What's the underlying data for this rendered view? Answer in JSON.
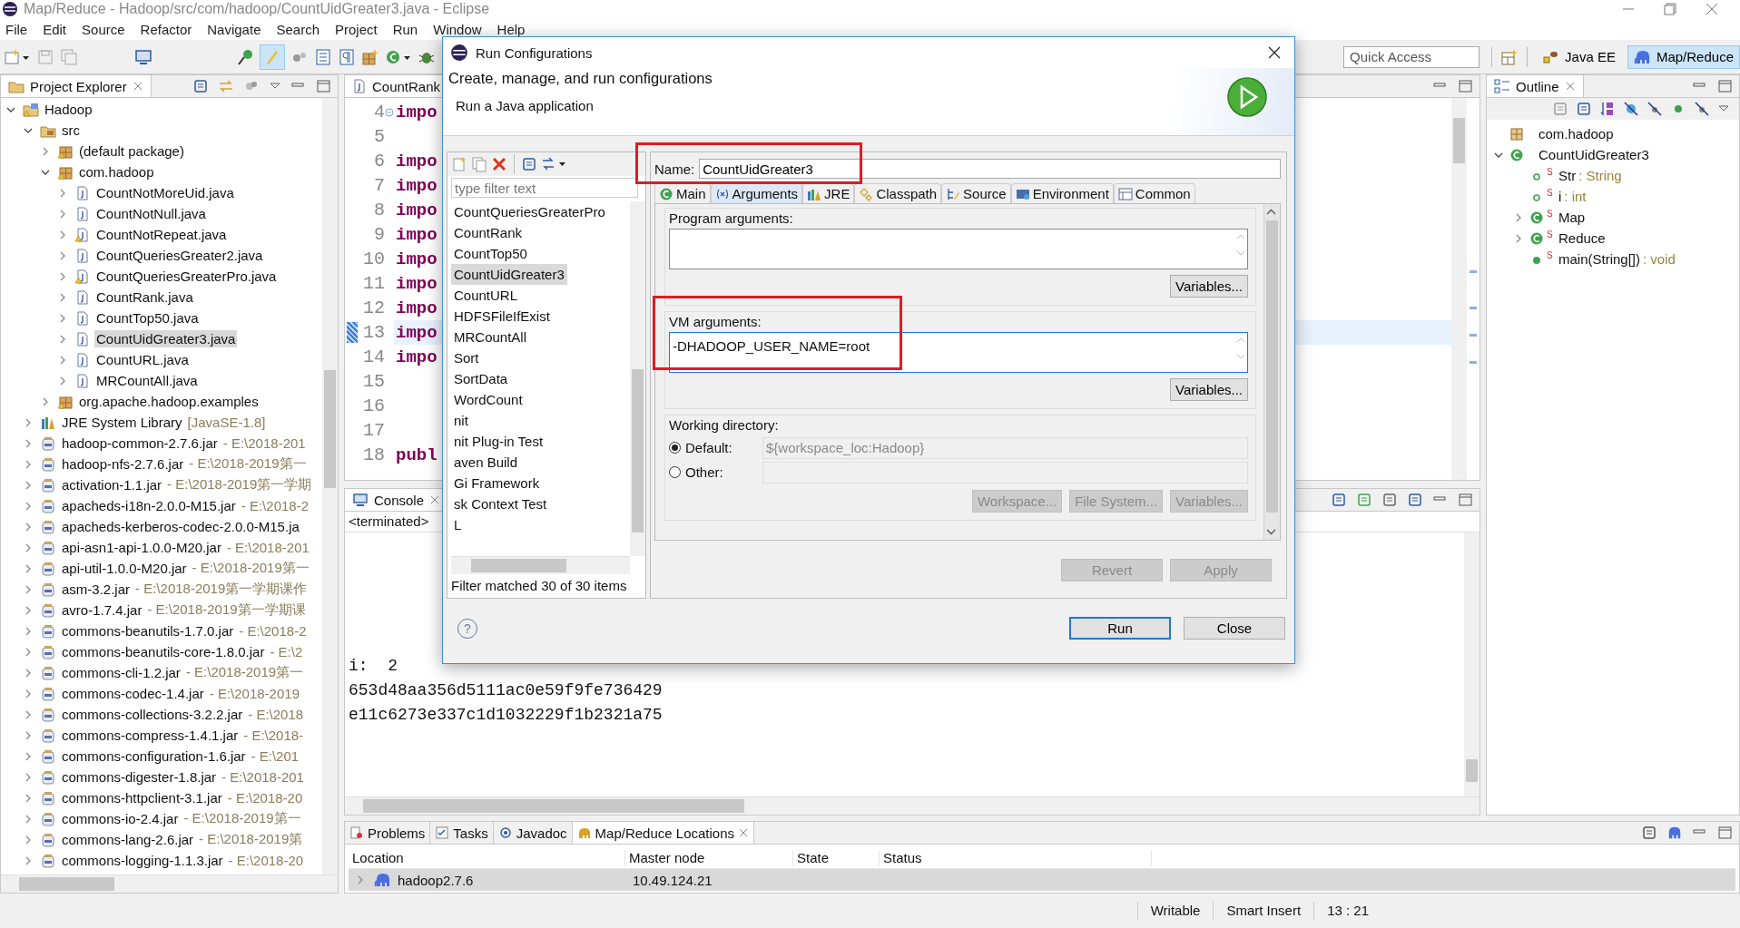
{
  "window": {
    "title": "Map/Reduce - Hadoop/src/com/hadoop/CountUidGreater3.java - Eclipse"
  },
  "menu": [
    "File",
    "Edit",
    "Source",
    "Refactor",
    "Navigate",
    "Search",
    "Project",
    "Run",
    "Window",
    "Help"
  ],
  "toolbar": {
    "quick_access": {
      "placeholder": "Quick Access"
    },
    "perspectives": [
      {
        "label": "Java EE",
        "kind": "javaee",
        "selected": false
      },
      {
        "label": "Map/Reduce",
        "kind": "mapreduce",
        "selected": true
      }
    ]
  },
  "project_explorer": {
    "title": "Project Explorer",
    "tree": [
      {
        "label": "Hadoop",
        "kind": "project",
        "warning": true,
        "expanded": true,
        "selected": false,
        "children": [
          {
            "label": "src",
            "kind": "folder",
            "warning": false,
            "expanded": true,
            "selected": false,
            "children": [
              {
                "label": "(default package)",
                "kind": "package",
                "warning": true,
                "expanded": false,
                "selected": false
              },
              {
                "label": "com.hadoop",
                "kind": "package",
                "warning": true,
                "expanded": true,
                "selected": false,
                "children": [
                  {
                    "label": "CountNotMoreUid.java",
                    "kind": "java",
                    "warning": false,
                    "expanded": false,
                    "selected": false
                  },
                  {
                    "label": "CountNotNull.java",
                    "kind": "java",
                    "warning": false,
                    "expanded": false,
                    "selected": false
                  },
                  {
                    "label": "CountNotRepeat.java",
                    "kind": "java",
                    "warning": true,
                    "expanded": false,
                    "selected": false
                  },
                  {
                    "label": "CountQueriesGreater2.java",
                    "kind": "java",
                    "warning": false,
                    "expanded": false,
                    "selected": false
                  },
                  {
                    "label": "CountQueriesGreaterPro.java",
                    "kind": "java",
                    "warning": true,
                    "expanded": false,
                    "selected": false
                  },
                  {
                    "label": "CountRank.java",
                    "kind": "java",
                    "warning": false,
                    "expanded": false,
                    "selected": false
                  },
                  {
                    "label": "CountTop50.java",
                    "kind": "java",
                    "warning": false,
                    "expanded": false,
                    "selected": false
                  },
                  {
                    "label": "CountUidGreater3.java",
                    "kind": "java",
                    "warning": false,
                    "expanded": false,
                    "selected": true
                  },
                  {
                    "label": "CountURL.java",
                    "kind": "java",
                    "warning": false,
                    "expanded": false,
                    "selected": false
                  },
                  {
                    "label": "MRCountAll.java",
                    "kind": "java",
                    "warning": false,
                    "expanded": false,
                    "selected": false
                  }
                ]
              },
              {
                "label": "org.apache.hadoop.examples",
                "kind": "package",
                "warning": true,
                "expanded": false,
                "selected": false
              }
            ]
          },
          {
            "label": "JRE System Library",
            "detail": "[JavaSE-1.8]",
            "kind": "library",
            "warning": false,
            "expanded": false,
            "selected": false
          },
          {
            "label": "hadoop-common-2.7.6.jar",
            "detail": "- E:\\2018-201",
            "kind": "jar",
            "warning": false,
            "expanded": false,
            "selected": false
          },
          {
            "label": "hadoop-nfs-2.7.6.jar",
            "detail": "- E:\\2018-2019第一",
            "kind": "jar",
            "warning": false,
            "expanded": false,
            "selected": false
          },
          {
            "label": "activation-1.1.jar",
            "detail": "- E:\\2018-2019第一学期",
            "kind": "jar",
            "warning": false,
            "expanded": false,
            "selected": false
          },
          {
            "label": "apacheds-i18n-2.0.0-M15.jar",
            "detail": "- E:\\2018-2",
            "kind": "jar",
            "warning": false,
            "expanded": false,
            "selected": false
          },
          {
            "label": "apacheds-kerberos-codec-2.0.0-M15.ja",
            "kind": "jar",
            "warning": false,
            "expanded": false,
            "selected": false
          },
          {
            "label": "api-asn1-api-1.0.0-M20.jar",
            "detail": "- E:\\2018-201",
            "kind": "jar",
            "warning": false,
            "expanded": false,
            "selected": false
          },
          {
            "label": "api-util-1.0.0-M20.jar",
            "detail": "- E:\\2018-2019第一",
            "kind": "jar",
            "warning": false,
            "expanded": false,
            "selected": false
          },
          {
            "label": "asm-3.2.jar",
            "detail": "- E:\\2018-2019第一学期课作",
            "kind": "jar",
            "warning": false,
            "expanded": false,
            "selected": false
          },
          {
            "label": "avro-1.7.4.jar",
            "detail": "- E:\\2018-2019第一学期课",
            "kind": "jar",
            "warning": false,
            "expanded": false,
            "selected": false
          },
          {
            "label": "commons-beanutils-1.7.0.jar",
            "detail": "- E:\\2018-2",
            "kind": "jar",
            "warning": false,
            "expanded": false,
            "selected": false
          },
          {
            "label": "commons-beanutils-core-1.8.0.jar",
            "detail": "- E:\\2",
            "kind": "jar",
            "warning": false,
            "expanded": false,
            "selected": false
          },
          {
            "label": "commons-cli-1.2.jar",
            "detail": "- E:\\2018-2019第一",
            "kind": "jar",
            "warning": false,
            "expanded": false,
            "selected": false
          },
          {
            "label": "commons-codec-1.4.jar",
            "detail": "- E:\\2018-2019",
            "kind": "jar",
            "warning": false,
            "expanded": false,
            "selected": false
          },
          {
            "label": "commons-collections-3.2.2.jar",
            "detail": "- E:\\2018",
            "kind": "jar",
            "warning": false,
            "expanded": false,
            "selected": false
          },
          {
            "label": "commons-compress-1.4.1.jar",
            "detail": "- E:\\2018-",
            "kind": "jar",
            "warning": false,
            "expanded": false,
            "selected": false
          },
          {
            "label": "commons-configuration-1.6.jar",
            "detail": "- E:\\201",
            "kind": "jar",
            "warning": false,
            "expanded": false,
            "selected": false
          },
          {
            "label": "commons-digester-1.8.jar",
            "detail": "- E:\\2018-201",
            "kind": "jar",
            "warning": false,
            "expanded": false,
            "selected": false
          },
          {
            "label": "commons-httpclient-3.1.jar",
            "detail": "- E:\\2018-20",
            "kind": "jar",
            "warning": false,
            "expanded": false,
            "selected": false
          },
          {
            "label": "commons-io-2.4.jar",
            "detail": "- E:\\2018-2019第一",
            "kind": "jar",
            "warning": false,
            "expanded": false,
            "selected": false
          },
          {
            "label": "commons-lang-2.6.jar",
            "detail": "- E:\\2018-2019第",
            "kind": "jar",
            "warning": false,
            "expanded": false,
            "selected": false
          },
          {
            "label": "commons-logging-1.1.3.jar",
            "detail": "- E:\\2018-20",
            "kind": "jar",
            "warning": false,
            "expanded": false,
            "selected": false
          }
        ]
      }
    ]
  },
  "editor": {
    "tab": "CountRank",
    "lines": [
      {
        "number": "4",
        "code": "impo",
        "fold": true,
        "current": false
      },
      {
        "number": "5",
        "fold": false,
        "current": false
      },
      {
        "number": "6",
        "code": "impo",
        "fold": false,
        "current": false
      },
      {
        "number": "7",
        "code": "impo",
        "fold": false,
        "current": false
      },
      {
        "number": "8",
        "code": "impo",
        "fold": false,
        "current": false
      },
      {
        "number": "9",
        "code": "impo",
        "fold": false,
        "current": false
      },
      {
        "number": "10",
        "code": "impo",
        "fold": false,
        "current": false
      },
      {
        "number": "11",
        "code": "impo",
        "fold": false,
        "current": false
      },
      {
        "number": "12",
        "code": "impo",
        "fold": false,
        "current": false
      },
      {
        "number": "13",
        "code": "impo",
        "fold": false,
        "current": true
      },
      {
        "number": "14",
        "code": "impo",
        "fold": false,
        "current": false
      },
      {
        "number": "15",
        "fold": false,
        "current": false
      },
      {
        "number": "16",
        "fold": false,
        "current": false
      },
      {
        "number": "17",
        "fold": false,
        "current": false
      },
      {
        "number": "18",
        "code": "publ",
        "fold": false,
        "current": false
      }
    ]
  },
  "console": {
    "title": "Console",
    "status": "<terminated>",
    "output": [
      "i:  2",
      "653d48aa356d5111ac0e59f9fe736429",
      "e11c6273e337c1d1032229f1b2321a75"
    ]
  },
  "outline": {
    "title": "Outline",
    "tree": [
      {
        "label": "com.hadoop",
        "kind": "package"
      },
      {
        "label": "CountUidGreater3",
        "kind": "class",
        "expanded": true,
        "children": [
          {
            "label": "Str",
            "type": ": String",
            "kind": "field",
            "modifier": "S"
          },
          {
            "label": "i",
            "type": ": int",
            "kind": "field",
            "modifier": "S"
          },
          {
            "label": "Map",
            "kind": "class",
            "modifier": "S",
            "expanded": false
          },
          {
            "label": "Reduce",
            "kind": "class",
            "modifier": "S",
            "expanded": false
          },
          {
            "label": "main(String[])",
            "type": ": void",
            "kind": "method",
            "modifier": "S"
          }
        ]
      }
    ]
  },
  "bottom_panel": {
    "tabs": [
      {
        "label": "Problems",
        "kind": "problems",
        "selected": false
      },
      {
        "label": "Tasks",
        "kind": "tasks",
        "selected": false
      },
      {
        "label": "Javadoc",
        "kind": "javadoc",
        "selected": false
      },
      {
        "label": "Map/Reduce Locations",
        "kind": "locations",
        "selected": true
      }
    ],
    "columns": [
      "Location",
      "Master node",
      "State",
      "Status"
    ],
    "rows": [
      {
        "location": "hadoop2.7.6",
        "master_node": "10.49.124.21",
        "selected": true,
        "expanded": false
      }
    ]
  },
  "status_bar": [
    "Writable",
    "Smart Insert",
    "13 : 21"
  ],
  "dialog": {
    "title": "Run Configurations",
    "heading": "Create, manage, and run configurations",
    "subtitle": "Run a Java application",
    "filter": {
      "placeholder": "type filter text"
    },
    "configurations": [
      {
        "label": "CountQueriesGreaterPro",
        "selected": false
      },
      {
        "label": "CountRank",
        "selected": false
      },
      {
        "label": "CountTop50",
        "selected": false
      },
      {
        "label": "CountUidGreater3",
        "selected": true
      },
      {
        "label": "CountURL",
        "selected": false
      },
      {
        "label": "HDFSFileIfExist",
        "selected": false
      },
      {
        "label": "MRCountAll",
        "selected": false
      },
      {
        "label": "Sort",
        "selected": false
      },
      {
        "label": "SortData",
        "selected": false
      },
      {
        "label": "WordCount",
        "selected": false
      },
      {
        "label": "nit",
        "selected": false
      },
      {
        "label": "nit Plug-in Test",
        "selected": false
      },
      {
        "label": "aven Build",
        "selected": false
      },
      {
        "label": "Gi Framework",
        "selected": false
      },
      {
        "label": "sk Context Test",
        "selected": false
      },
      {
        "label": "L",
        "selected": false
      }
    ],
    "filter_status": "Filter matched 30 of 30 items",
    "name": {
      "label": "Name:",
      "value": "CountUidGreater3",
      "highlighted": true
    },
    "tabs": [
      {
        "label": "Main",
        "kind": "main",
        "selected": false
      },
      {
        "label": "Arguments",
        "kind": "arguments",
        "selected": true
      },
      {
        "label": "JRE",
        "kind": "jre",
        "selected": false
      },
      {
        "label": "Classpath",
        "kind": "classpath",
        "selected": false
      },
      {
        "label": "Source",
        "kind": "source",
        "selected": false
      },
      {
        "label": "Environment",
        "kind": "environment",
        "selected": false
      },
      {
        "label": "Common",
        "kind": "common",
        "selected": false
      }
    ],
    "program_arguments": {
      "label": "Program arguments:",
      "focused": false,
      "button": "Variables..."
    },
    "vm_arguments": {
      "label": "VM arguments:",
      "value": "-DHADOOP_USER_NAME=root",
      "highlighted": true,
      "focused": true,
      "button": "Variables..."
    },
    "working_directory": {
      "label": "Working directory:",
      "options": [
        {
          "label": "Default:",
          "selected": true,
          "value": "${workspace_loc:Hadoop}"
        },
        {
          "label": "Other:",
          "selected": false
        }
      ],
      "buttons": [
        {
          "label": "Workspace...",
          "disabled": true
        },
        {
          "label": "File System...",
          "disabled": true
        },
        {
          "label": "Variables...",
          "disabled": true
        }
      ]
    },
    "actions": [
      {
        "label": "Revert",
        "disabled": true
      },
      {
        "label": "Apply",
        "disabled": true
      }
    ],
    "help": "?",
    "buttons": [
      {
        "label": "Run",
        "default": true
      },
      {
        "label": "Close",
        "default": false
      }
    ]
  }
}
